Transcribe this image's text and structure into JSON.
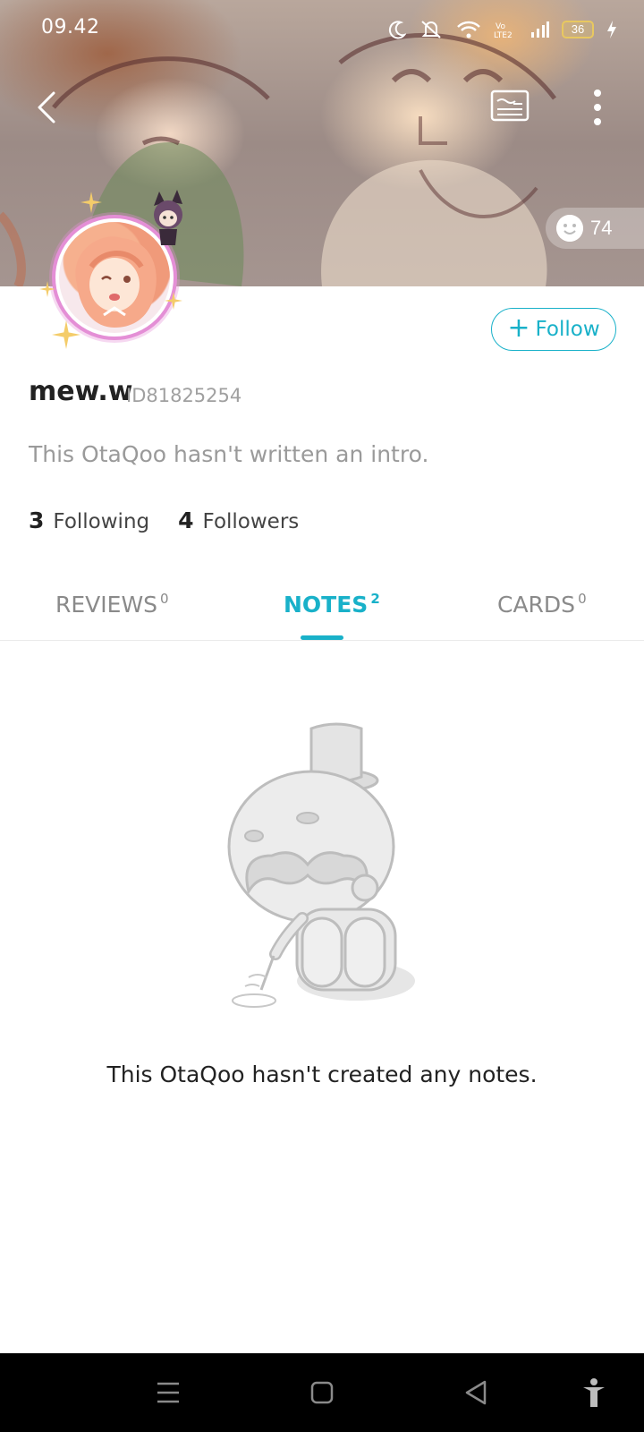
{
  "status_bar": {
    "time": "09.42",
    "battery": "36"
  },
  "header": {
    "likes_count": "74"
  },
  "profile": {
    "follow_label": "Follow",
    "username": "mew.w",
    "user_id": "ID81825254",
    "intro": "This OtaQoo hasn't written an intro.",
    "following_count": "3",
    "following_label": "Following",
    "followers_count": "4",
    "followers_label": "Followers"
  },
  "tabs": [
    {
      "label": "REVIEWS",
      "count": "0",
      "active": false
    },
    {
      "label": "NOTES",
      "count": "2",
      "active": true
    },
    {
      "label": "CARDS",
      "count": "0",
      "active": false
    }
  ],
  "empty_state": {
    "message": "This OtaQoo hasn't created any notes."
  },
  "colors": {
    "accent": "#19b1c9",
    "avatar_ring": "#e48fd6"
  },
  "icons": [
    "back-arrow-icon",
    "profile-card-icon",
    "more-vertical-icon",
    "smile-icon",
    "plus-icon",
    "menu-icon",
    "home-square-icon",
    "back-triangle-icon",
    "accessibility-icon"
  ]
}
